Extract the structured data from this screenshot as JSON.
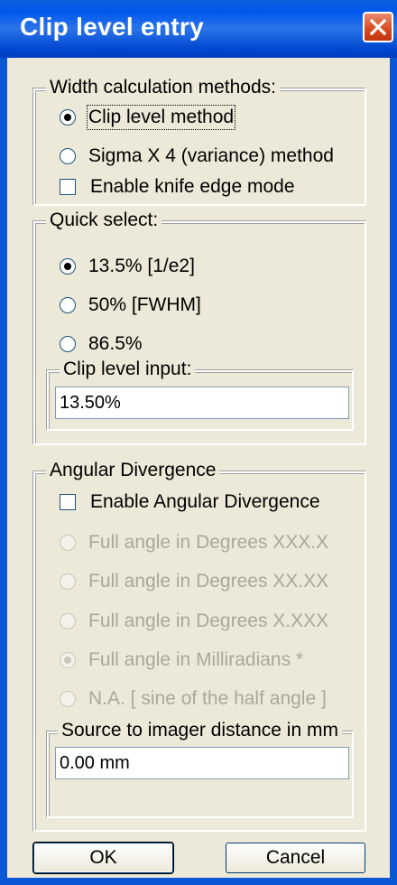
{
  "window": {
    "title": "Clip level entry",
    "close_icon": "close-icon"
  },
  "width_methods": {
    "legend": "Width calculation methods:",
    "options": [
      "Clip level method",
      "Sigma X 4 (variance) method"
    ],
    "selected": 0,
    "knife_edge_label": "Enable knife edge mode",
    "knife_edge_checked": false
  },
  "quick_select": {
    "legend": "Quick select:",
    "options": [
      "13.5% [1/e2]",
      "50% [FWHM]",
      "86.5%"
    ],
    "selected": 0,
    "clip_input_legend": "Clip level input:",
    "clip_input_value": "13.50%"
  },
  "angular": {
    "legend": "Angular Divergence",
    "enable_label": "Enable Angular Divergence",
    "enable_checked": false,
    "options": [
      "Full angle in Degrees XXX.X",
      "Full angle in Degrees XX.XX",
      "Full angle in Degrees X.XXX",
      "Full angle in Milliradians  *",
      "N.A.  [ sine of the half angle ]"
    ],
    "selected": 3,
    "distance_legend": "Source to imager distance in mm",
    "distance_value": "0.00 mm"
  },
  "buttons": {
    "ok": "OK",
    "cancel": "Cancel"
  }
}
